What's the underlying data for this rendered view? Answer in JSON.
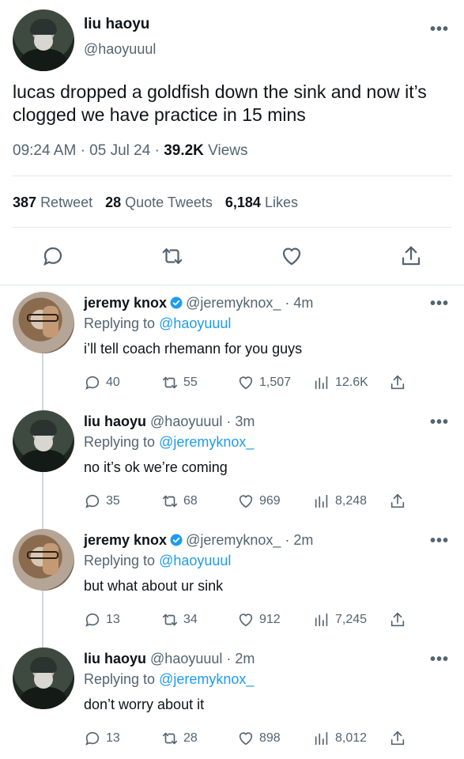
{
  "main_tweet": {
    "author_name": "liu haoyu",
    "author_handle": "@haoyuuul",
    "text": "lucas dropped a goldfish down the sink and now it’s clogged we have practice in 15 mins",
    "time": "09:24 AM",
    "date": "05 Jul 24",
    "views_count": "39.2K",
    "views_label": "Views",
    "retweet_count": "387",
    "retweet_label": "Retweet",
    "quote_count": "28",
    "quote_label": "Quote Tweets",
    "likes_count": "6,184",
    "likes_label": "Likes",
    "more": "•••"
  },
  "replies": [
    {
      "name": "jeremy knox",
      "verified": true,
      "handle": "@jeremyknox_",
      "time": "4m",
      "replying_prefix": "Replying to",
      "replying_to": "@haoyuuul",
      "text": "i’ll tell coach rhemann for you guys",
      "reply_count": "40",
      "retweet_count": "55",
      "like_count": "1,507",
      "view_count": "12.6K",
      "more": "•••"
    },
    {
      "name": "liu haoyu",
      "verified": false,
      "handle": "@haoyuuul",
      "time": "3m",
      "replying_prefix": "Replying to",
      "replying_to": "@jeremyknox_",
      "text": "no it’s ok we’re coming",
      "reply_count": "35",
      "retweet_count": "68",
      "like_count": "969",
      "view_count": "8,248",
      "more": "•••"
    },
    {
      "name": "jeremy knox",
      "verified": true,
      "handle": "@jeremyknox_",
      "time": "2m",
      "replying_prefix": "Replying to",
      "replying_to": "@haoyuuul",
      "text": "but what about ur sink",
      "reply_count": "13",
      "retweet_count": "34",
      "like_count": "912",
      "view_count": "7,245",
      "more": "•••"
    },
    {
      "name": "liu haoyu",
      "verified": false,
      "handle": "@haoyuuul",
      "time": "2m",
      "replying_prefix": "Replying to",
      "replying_to": "@jeremyknox_",
      "text": "don’t worry about it",
      "reply_count": "13",
      "retweet_count": "28",
      "like_count": "898",
      "view_count": "8,012",
      "more": "•••"
    }
  ],
  "colors": {
    "text": "#0f1419",
    "secondary": "#536471",
    "link": "#1d9bf0",
    "divider": "#e1e8ed"
  },
  "icons": [
    "comment-icon",
    "retweet-icon",
    "heart-icon",
    "share-icon",
    "views-icon",
    "verified-badge-icon",
    "more-icon"
  ]
}
